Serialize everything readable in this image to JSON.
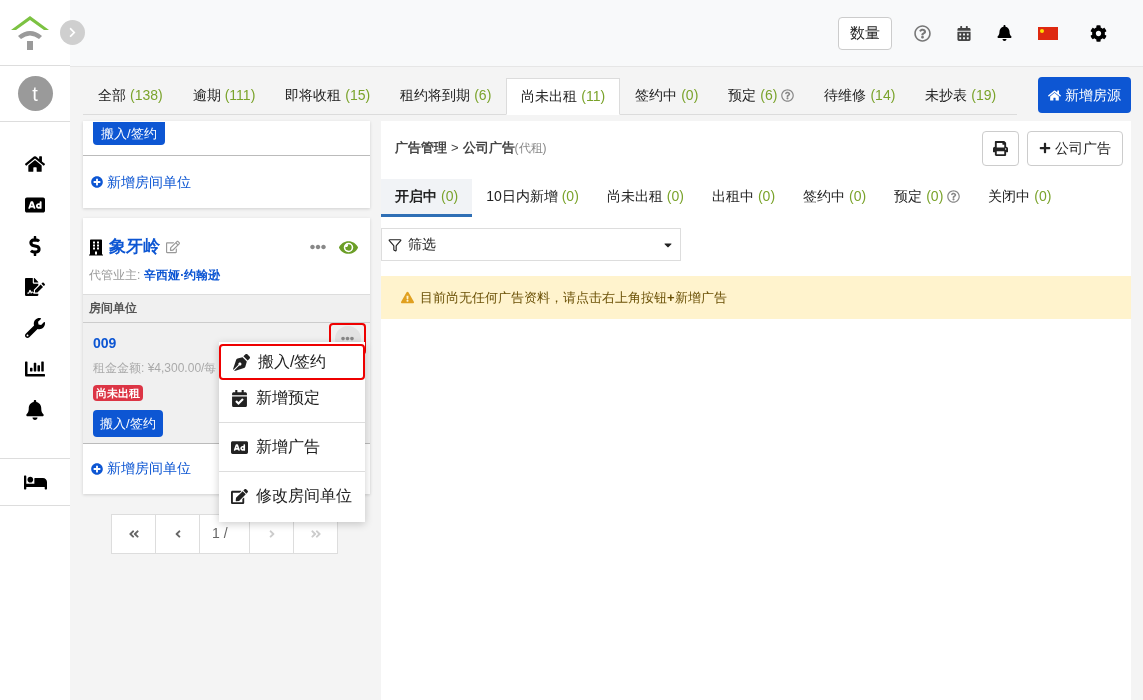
{
  "header": {
    "count_button": "数量"
  },
  "user": {
    "initial": "t"
  },
  "tabs": [
    {
      "label": "全部",
      "count": "(138)",
      "selected": false,
      "help": false
    },
    {
      "label": "逾期",
      "count": "(111)",
      "selected": false,
      "help": false
    },
    {
      "label": "即将收租",
      "count": "(15)",
      "selected": false,
      "help": false
    },
    {
      "label": "租约将到期",
      "count": "(6)",
      "selected": false,
      "help": false
    },
    {
      "label": "尚未出租",
      "count": "(11)",
      "selected": true,
      "help": false
    },
    {
      "label": "签约中",
      "count": "(0)",
      "selected": false,
      "help": false
    },
    {
      "label": "预定",
      "count": "(6)",
      "selected": false,
      "help": true
    },
    {
      "label": "待维修",
      "count": "(14)",
      "selected": false,
      "help": false
    },
    {
      "label": "未抄表",
      "count": "(19)",
      "selected": false,
      "help": false
    }
  ],
  "add_property_button": "新增房源",
  "previous_card": {
    "sign_button": "搬入/签约",
    "add_unit": "新增房间单位"
  },
  "property": {
    "name": "象牙岭",
    "owner_label": "代管业主:",
    "owner": "辛西娅·约翰逊",
    "units_heading": "房间单位",
    "unit": {
      "number": "009",
      "rent": "租金金额: ¥4,300.00/每",
      "status": "尚未出租",
      "sign_button": "搬入/签约",
      "more_highlighted": true
    },
    "add_unit": "新增房间单位"
  },
  "unit_menu": [
    [
      {
        "kind": "pen",
        "label": "搬入/签约",
        "selected": true
      },
      {
        "kind": "calendar",
        "label": "新增预定",
        "selected": false
      }
    ],
    [
      {
        "kind": "ad",
        "label": "新增广告",
        "selected": false
      }
    ],
    [
      {
        "kind": "edit",
        "label": "修改房间单位",
        "selected": false
      }
    ]
  ],
  "pagination": {
    "page": "1 /"
  },
  "breadcrumb": {
    "parent": "广告管理",
    "separator": ">",
    "current": "公司广告",
    "suffix": "(代租)"
  },
  "add_ad_button": "公司广告",
  "ad_tabs": [
    {
      "label": "开启中",
      "count": "(0)",
      "selected": true,
      "help": false
    },
    {
      "label": "10日内新增",
      "count": "(0)",
      "selected": false,
      "help": false
    },
    {
      "label": "尚未出租",
      "count": "(0)",
      "selected": false,
      "help": false
    },
    {
      "label": "出租中",
      "count": "(0)",
      "selected": false,
      "help": false
    },
    {
      "label": "签约中",
      "count": "(0)",
      "selected": false,
      "help": false
    },
    {
      "label": "预定",
      "count": "(0)",
      "selected": false,
      "help": true
    },
    {
      "label": "关闭中",
      "count": "(0)",
      "selected": false,
      "help": false
    }
  ],
  "filter": {
    "placeholder": "筛选"
  },
  "alert": "目前尚无任何广告资料，请点击右上角按钮**+**新增广告"
}
